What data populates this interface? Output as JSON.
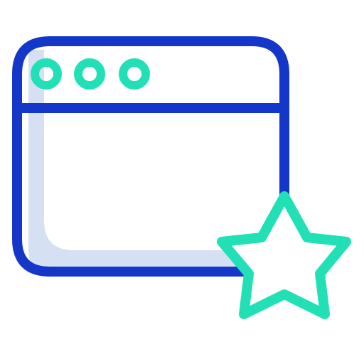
{
  "icon": {
    "name": "browser-window-favorite-icon",
    "parts": {
      "window": "browser-window-icon",
      "dots": [
        "window-dot-icon",
        "window-dot-icon",
        "window-dot-icon"
      ],
      "star": "star-icon"
    }
  },
  "colors": {
    "window_stroke": "#1537c9",
    "window_fill_shadow": "#d6e0f3",
    "accent": "#22e0b6",
    "background": "#ffffff"
  }
}
